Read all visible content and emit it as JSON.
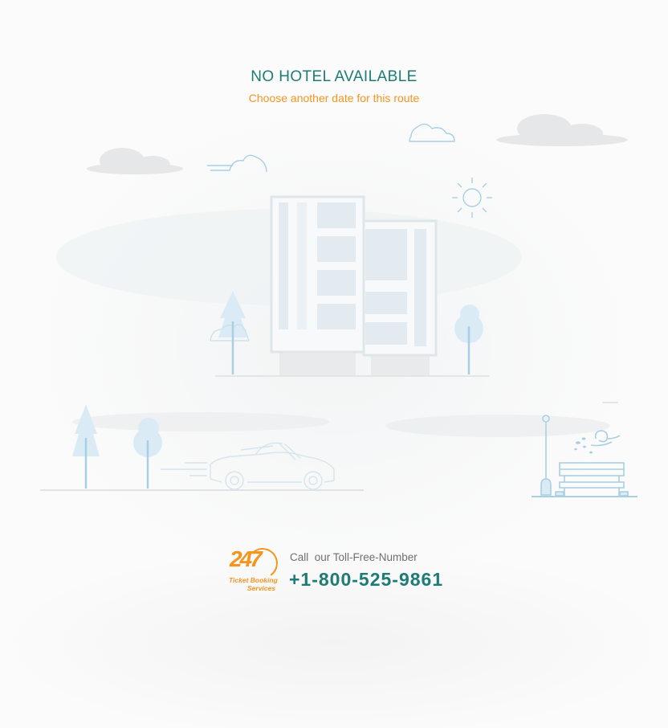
{
  "empty_state": {
    "title": "NO HOTEL AVAILABLE",
    "subtitle": "Choose another date for this route"
  },
  "contact": {
    "logo_number": "247",
    "logo_line1": "Ticket Booking",
    "logo_line2": "Services",
    "call_label": "Call  our Toll-Free-Number",
    "phone": "+1-800-525-9861"
  },
  "colors": {
    "title": "#1d7c75",
    "subtitle": "#f5951f",
    "phone": "#1d7c75",
    "logo": "#f5951f",
    "illustration_line": "#a9cfe3",
    "illustration_fill": "#e2eef5"
  }
}
